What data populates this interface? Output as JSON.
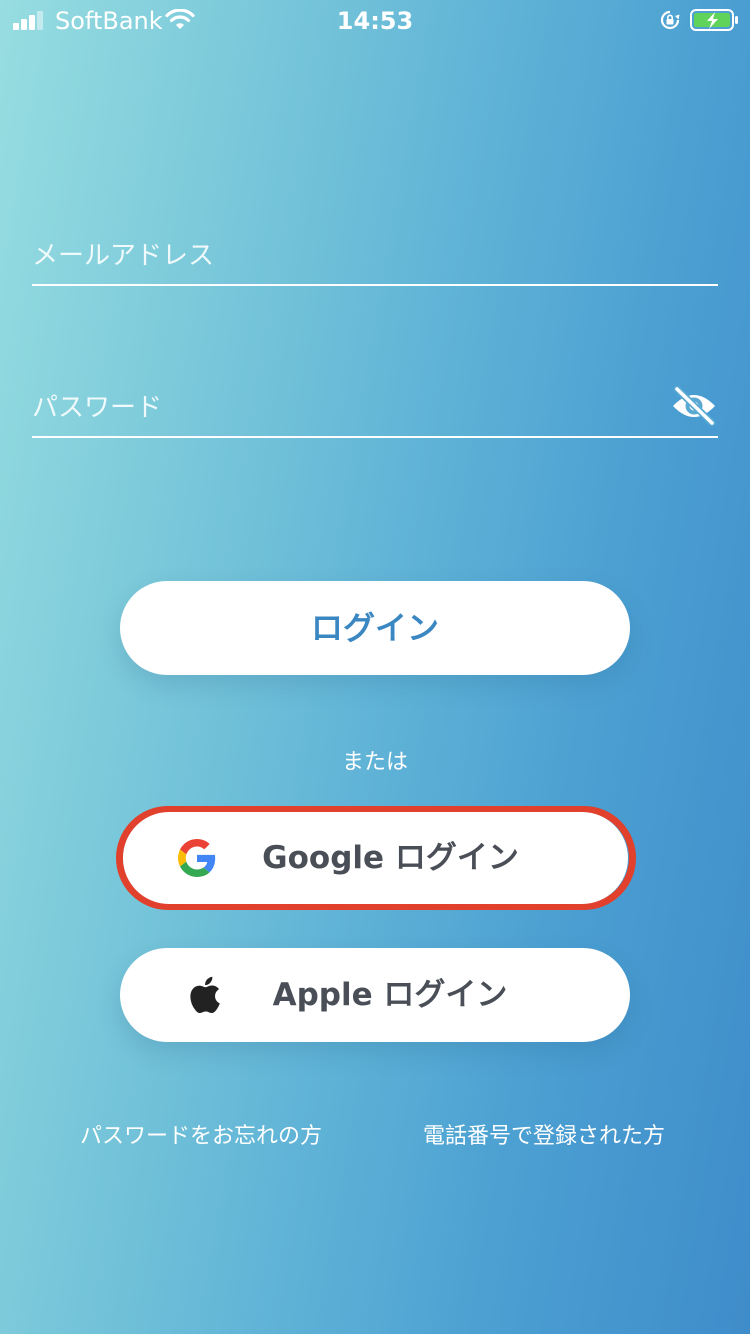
{
  "status_bar": {
    "carrier": "SoftBank",
    "time": "14:53",
    "icons": [
      "signal-icon",
      "wifi-icon",
      "rotation-lock-icon",
      "battery-charging-icon"
    ]
  },
  "form": {
    "email_placeholder": "メールアドレス",
    "email_value": "",
    "password_placeholder": "パスワード",
    "password_value": "",
    "password_toggle_icon": "eye-off-icon"
  },
  "login_button": {
    "label": "ログイン"
  },
  "divider": {
    "text": "または"
  },
  "google_button": {
    "label": "Google ログイン",
    "icon": "google-icon",
    "highlight_color": "#e0402c"
  },
  "apple_button": {
    "label": "Apple ログイン",
    "icon": "apple-icon"
  },
  "links": {
    "forgot_password": "パスワードをお忘れの方",
    "phone_registered": "電話番号で登録された方"
  },
  "colors": {
    "gradient_left": "#97dde1",
    "gradient_right": "#3f8cca",
    "accent": "#3a87c2",
    "button_text": "#4a4f57"
  }
}
